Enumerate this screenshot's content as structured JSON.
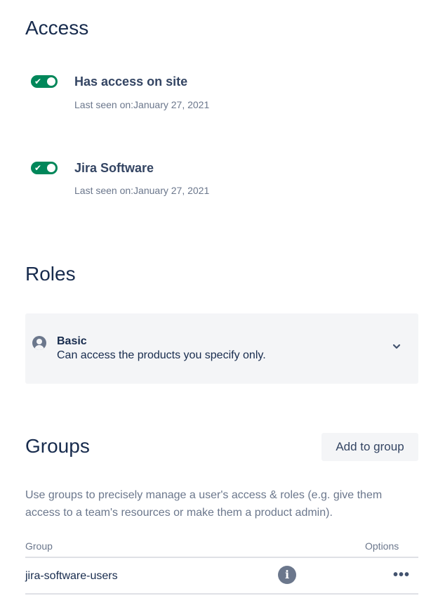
{
  "access": {
    "heading": "Access",
    "items": [
      {
        "title": "Has access on site",
        "last_seen": "Last seen on:January 27, 2021",
        "enabled": true
      },
      {
        "title": "Jira Software",
        "last_seen": "Last seen on:January 27, 2021",
        "enabled": true
      }
    ]
  },
  "roles": {
    "heading": "Roles",
    "selected": {
      "name": "Basic",
      "description": "Can access the products you specify only."
    }
  },
  "groups": {
    "heading": "Groups",
    "add_button_label": "Add to group",
    "description": "Use groups to precisely manage a user's access & roles (e.g. give them access to a team's resources or make them a product admin).",
    "columns": {
      "group": "Group",
      "options": "Options"
    },
    "rows": [
      {
        "name": "jira-software-users",
        "info_glyph": "i",
        "options_glyph": "•••"
      }
    ]
  },
  "icons": {
    "toggle_check": "check-icon",
    "role": "person-icon",
    "dropdown": "chevron-down-icon",
    "info": "info-icon",
    "more": "more-horizontal-icon"
  },
  "colors": {
    "toggle_on": "#00875a",
    "heading": "#172b4d",
    "muted": "#6b778c",
    "panel": "#f4f5f7"
  }
}
